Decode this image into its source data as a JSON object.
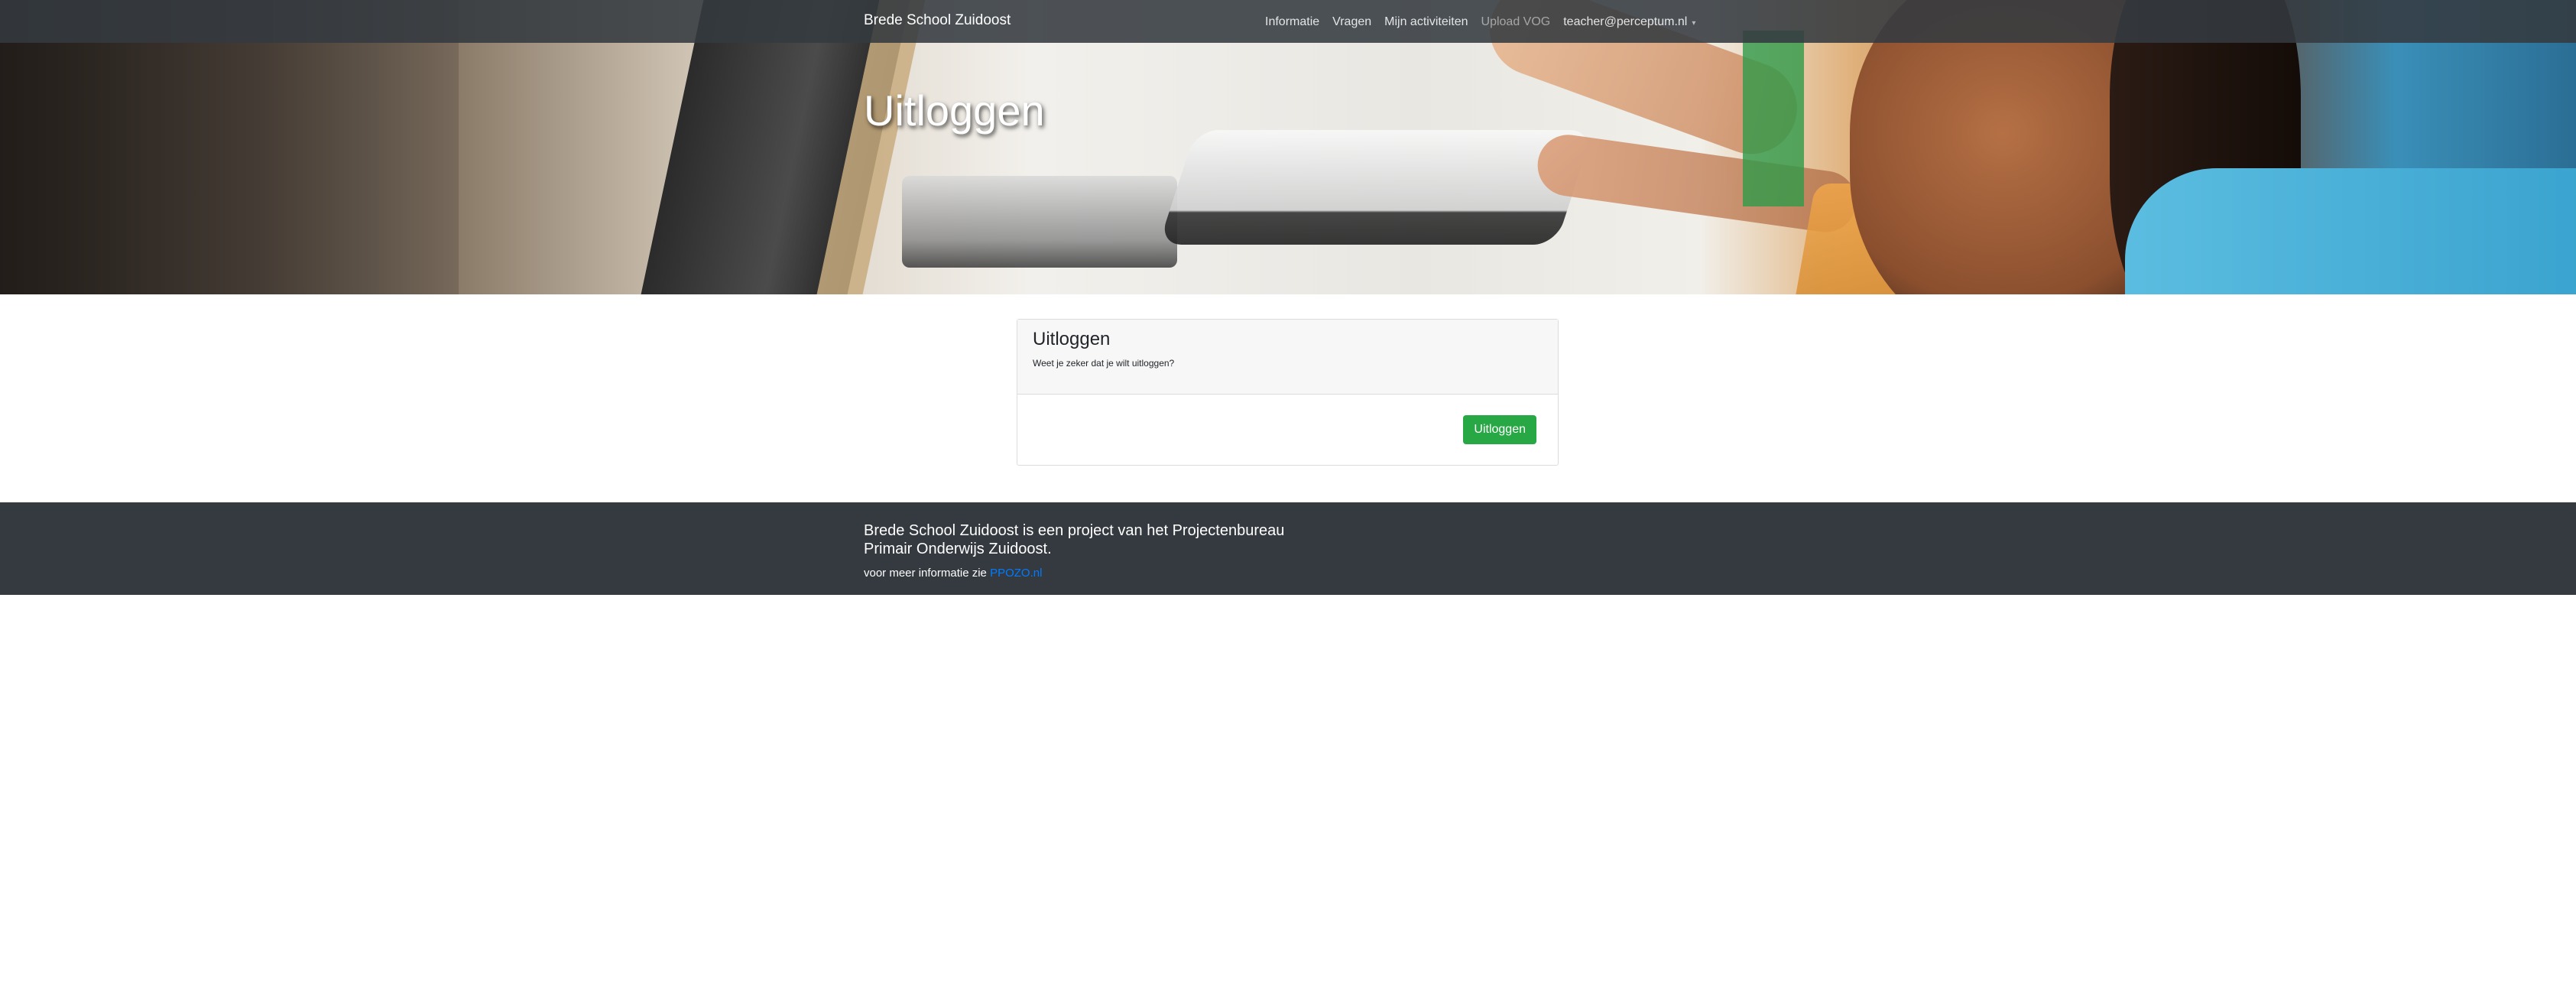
{
  "navbar": {
    "brand": "Brede School Zuidoost",
    "links": [
      "Informatie",
      "Vragen",
      "Mijn activiteiten",
      "Upload VOG"
    ],
    "user_email": "teacher@perceptum.nl"
  },
  "hero": {
    "title": "Uitloggen"
  },
  "card": {
    "title": "Uitloggen",
    "text": "Weet je zeker dat je wilt uitloggen?",
    "button_label": "Uitloggen"
  },
  "footer": {
    "line1": "Brede School Zuidoost is een project van het Projectenbureau Primair Onderwijs Zuidoost.",
    "line2_prefix": "voor meer informatie zie",
    "link_text": "PPOZO.nl"
  },
  "colors": {
    "navbar_bg": "#343a40",
    "button_green": "#28a745",
    "link_blue": "#007bff"
  }
}
